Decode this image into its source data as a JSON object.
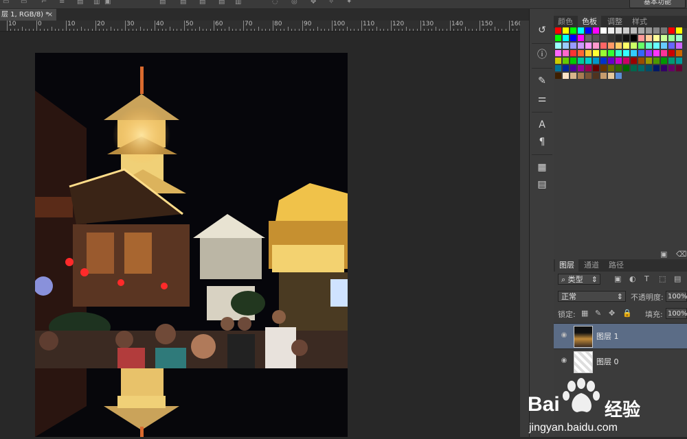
{
  "document": {
    "tab_title": "层 1, RGB/8) *",
    "close_glyph": "×"
  },
  "ruler": {
    "labels": [
      "10",
      "0",
      "10",
      "20",
      "30",
      "40",
      "50",
      "60",
      "70",
      "80",
      "90",
      "100",
      "110",
      "120",
      "130",
      "140",
      "150",
      "160"
    ]
  },
  "top_bar": {
    "collapse_glyph": "◂◂",
    "workspace_label": "基本功能"
  },
  "tool_icons": [
    "history-icon",
    "info-icon",
    "brush-icon",
    "brush-settings-icon",
    "character-icon",
    "paragraph-icon",
    "glyph-panel-icon",
    "notes-icon"
  ],
  "color_panel": {
    "tabs": [
      "颜色",
      "色板",
      "调整",
      "样式"
    ],
    "active_tab": "色板",
    "swatch_rows": [
      [
        "#ff0000",
        "#ffff00",
        "#00ff00",
        "#00ffff",
        "#0000ff",
        "#ff00ff",
        "#ffffff",
        "#eeeeee",
        "#dddddd",
        "#cccccc",
        "#bbbbbb",
        "#aaaaaa",
        "#999999",
        "#888888",
        "#777777",
        "#ff0000",
        "#ffff00"
      ],
      [
        "#00ff00",
        "#00ffff",
        "#0000ff",
        "#ff00ff",
        "#666666",
        "#555555",
        "#444444",
        "#333333",
        "#222222",
        "#111111",
        "#000000",
        "#ff9999",
        "#ffcc99",
        "#ffff99",
        "#ccff99",
        "#99ff99",
        "#99ffcc"
      ],
      [
        "#99ffff",
        "#99ccff",
        "#9999ff",
        "#cc99ff",
        "#ff99ff",
        "#ff99cc",
        "#ff6666",
        "#ff9966",
        "#ffcc66",
        "#ffff66",
        "#ccff66",
        "#66ff66",
        "#66ffcc",
        "#66ffff",
        "#66ccff",
        "#6666ff",
        "#cc66ff"
      ],
      [
        "#ff66ff",
        "#ff66cc",
        "#ff3333",
        "#ff6633",
        "#ffcc33",
        "#ffff33",
        "#99ff33",
        "#33ff33",
        "#33ffcc",
        "#33ffff",
        "#33ccff",
        "#3366ff",
        "#9933ff",
        "#ff33ff",
        "#ff3399",
        "#cc0000",
        "#cc6600"
      ],
      [
        "#cccc00",
        "#66cc00",
        "#00cc00",
        "#00cc99",
        "#00cccc",
        "#0099cc",
        "#0033cc",
        "#6600cc",
        "#cc00cc",
        "#cc0066",
        "#990000",
        "#994c00",
        "#999900",
        "#4c9900",
        "#009900",
        "#009973",
        "#009999"
      ],
      [
        "#007399",
        "#002699",
        "#4c0099",
        "#990099",
        "#99004c",
        "#660000",
        "#663300",
        "#666600",
        "#336600",
        "#006600",
        "#00664c",
        "#006666",
        "#004c66",
        "#001966",
        "#330066",
        "#660066",
        "#660033"
      ],
      [
        "#3d1f00",
        "#fbe3c8",
        "#d8b48c",
        "#a87c52",
        "#7a5436",
        "#4f331f",
        "#c69c6d",
        "#e6c79a",
        "#5b8fd6"
      ]
    ],
    "delete_glyph": "🗑"
  },
  "layers_panel": {
    "tabs": [
      "图层",
      "通道",
      "路径"
    ],
    "active_tab": "图层",
    "filter_label": "类型",
    "blend_mode": "正常",
    "opacity_label": "不透明度:",
    "opacity_value": "100%",
    "lock_label": "锁定:",
    "fill_label": "填充:",
    "fill_value": "100%",
    "layers": [
      {
        "name": "图层 1",
        "selected": true
      },
      {
        "name": "图层 0",
        "selected": false
      }
    ]
  },
  "watermark": {
    "brand": "Bai",
    "brand_suffix": "经验",
    "url": "jingyan.baidu.com"
  }
}
